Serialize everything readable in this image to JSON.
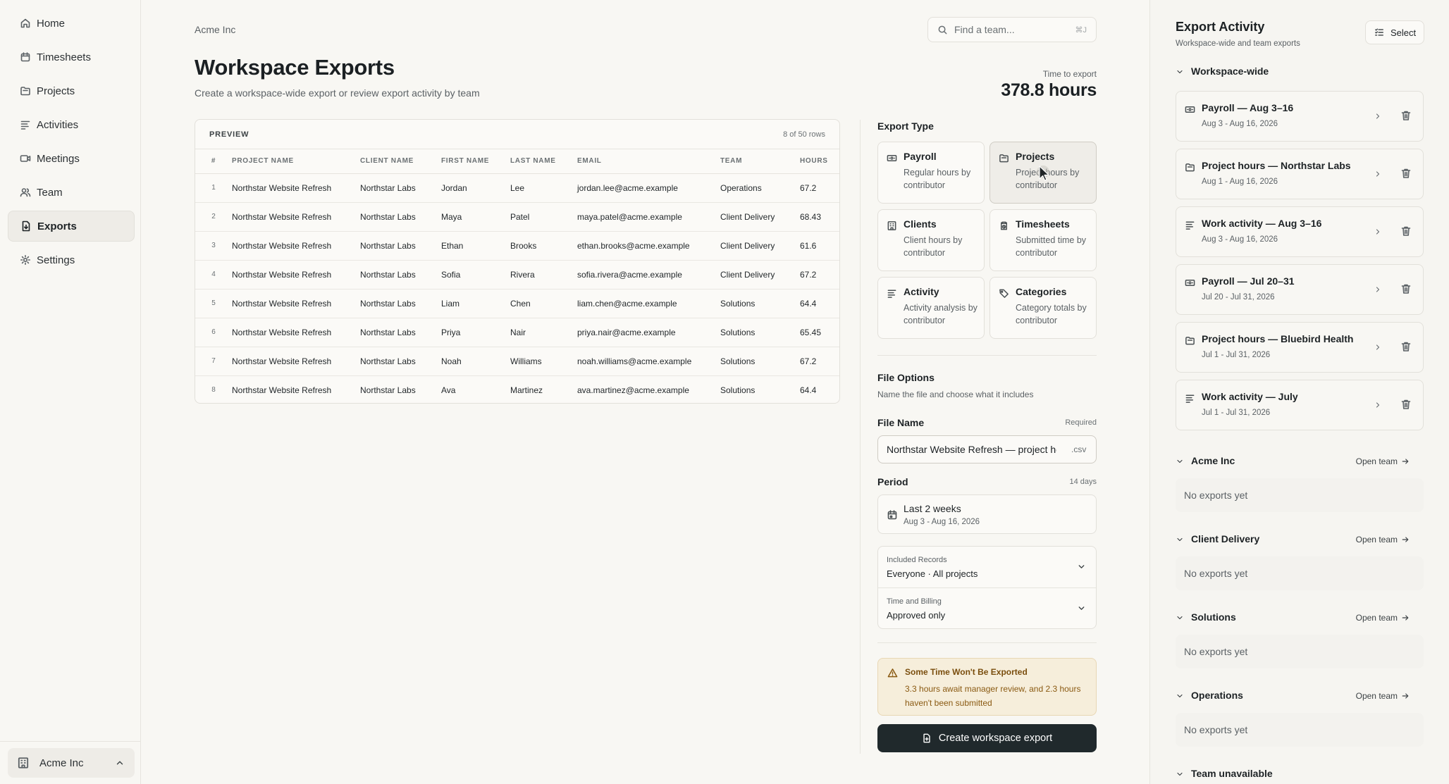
{
  "sidebar": {
    "items": [
      {
        "label": "Home",
        "icon": "home-icon"
      },
      {
        "label": "Timesheets",
        "icon": "calendar-icon"
      },
      {
        "label": "Projects",
        "icon": "folder-icon"
      },
      {
        "label": "Activities",
        "icon": "lines-icon"
      },
      {
        "label": "Meetings",
        "icon": "video-icon"
      },
      {
        "label": "Team",
        "icon": "users-icon"
      },
      {
        "label": "Exports",
        "icon": "file-export-icon",
        "active": true
      },
      {
        "label": "Settings",
        "icon": "gear-icon"
      }
    ],
    "org": "Acme Inc"
  },
  "header": {
    "breadcrumb": "Acme Inc",
    "search_placeholder": "Find a team...",
    "search_shortcut": "⌘J",
    "title": "Workspace Exports",
    "subtitle": "Create a workspace-wide export or review export activity by team",
    "time_label": "Time to export",
    "time_value": "378.8 hours"
  },
  "preview": {
    "label": "PREVIEW",
    "count": "8 of 50 rows",
    "columns": [
      "#",
      "PROJECT NAME",
      "CLIENT NAME",
      "FIRST NAME",
      "LAST NAME",
      "EMAIL",
      "TEAM",
      "HOURS"
    ],
    "rows": [
      [
        "1",
        "Northstar Website Refresh",
        "Northstar Labs",
        "Jordan",
        "Lee",
        "jordan.lee@acme.example",
        "Operations",
        "67.2"
      ],
      [
        "2",
        "Northstar Website Refresh",
        "Northstar Labs",
        "Maya",
        "Patel",
        "maya.patel@acme.example",
        "Client Delivery",
        "68.43"
      ],
      [
        "3",
        "Northstar Website Refresh",
        "Northstar Labs",
        "Ethan",
        "Brooks",
        "ethan.brooks@acme.example",
        "Client Delivery",
        "61.6"
      ],
      [
        "4",
        "Northstar Website Refresh",
        "Northstar Labs",
        "Sofia",
        "Rivera",
        "sofia.rivera@acme.example",
        "Client Delivery",
        "67.2"
      ],
      [
        "5",
        "Northstar Website Refresh",
        "Northstar Labs",
        "Liam",
        "Chen",
        "liam.chen@acme.example",
        "Solutions",
        "64.4"
      ],
      [
        "6",
        "Northstar Website Refresh",
        "Northstar Labs",
        "Priya",
        "Nair",
        "priya.nair@acme.example",
        "Solutions",
        "65.45"
      ],
      [
        "7",
        "Northstar Website Refresh",
        "Northstar Labs",
        "Noah",
        "Williams",
        "noah.williams@acme.example",
        "Solutions",
        "67.2"
      ],
      [
        "8",
        "Northstar Website Refresh",
        "Northstar Labs",
        "Ava",
        "Martinez",
        "ava.martinez@acme.example",
        "Solutions",
        "64.4"
      ]
    ]
  },
  "export_type": {
    "title": "Export Type",
    "cards": [
      {
        "title": "Payroll",
        "desc": "Regular hours by contributor",
        "icon": "banknote-icon"
      },
      {
        "title": "Projects",
        "desc": "Project hours by contributor",
        "icon": "folder-icon",
        "selected": true
      },
      {
        "title": "Clients",
        "desc": "Client hours by contributor",
        "icon": "building-icon"
      },
      {
        "title": "Timesheets",
        "desc": "Submitted time by contributor",
        "icon": "clipboard-clock-icon"
      },
      {
        "title": "Activity",
        "desc": "Activity analysis by contributor",
        "icon": "lines-icon"
      },
      {
        "title": "Categories",
        "desc": "Category totals by contributor",
        "icon": "tag-icon"
      }
    ]
  },
  "file_options": {
    "title": "File Options",
    "subtitle": "Name the file and choose what it includes",
    "file_name_label": "File Name",
    "file_name_hint": "Required",
    "file_name_value": "Northstar Website Refresh — project hours",
    "file_ext": ".csv",
    "period_label": "Period",
    "period_hint": "14 days",
    "period_main": "Last 2 weeks",
    "period_range": "Aug 3 - Aug 16, 2026",
    "records_label": "Included Records",
    "records_value": "Everyone · All projects",
    "billing_label": "Time and Billing",
    "billing_value": "Approved only"
  },
  "warning": {
    "title": "Some Time Won't Be Exported",
    "body": "3.3 hours await manager review, and 2.3 hours haven't been submitted"
  },
  "create_button": "Create workspace export",
  "activity": {
    "title": "Export Activity",
    "subtitle": "Workspace-wide and team exports",
    "select_label": "Select",
    "workspace_group": "Workspace-wide",
    "exports": [
      {
        "title": "Payroll — Aug 3–16",
        "date": "Aug 3 - Aug 16, 2026",
        "icon": "banknote-icon"
      },
      {
        "title": "Project hours — Northstar Labs",
        "date": "Aug 1 - Aug 16, 2026",
        "icon": "folder-icon"
      },
      {
        "title": "Work activity — Aug 3–16",
        "date": "Aug 3 - Aug 16, 2026",
        "icon": "lines-icon"
      },
      {
        "title": "Payroll — Jul 20–31",
        "date": "Jul 20 - Jul 31, 2026",
        "icon": "banknote-icon"
      },
      {
        "title": "Project hours — Bluebird Health",
        "date": "Jul 1 - Jul 31, 2026",
        "icon": "folder-icon"
      },
      {
        "title": "Work activity — July",
        "date": "Jul 1 - Jul 31, 2026",
        "icon": "lines-icon"
      }
    ],
    "open_team": "Open team",
    "empty_text": "No exports yet",
    "teams": [
      "Acme Inc",
      "Client Delivery",
      "Solutions",
      "Operations"
    ],
    "unavailable": "Team unavailable"
  }
}
